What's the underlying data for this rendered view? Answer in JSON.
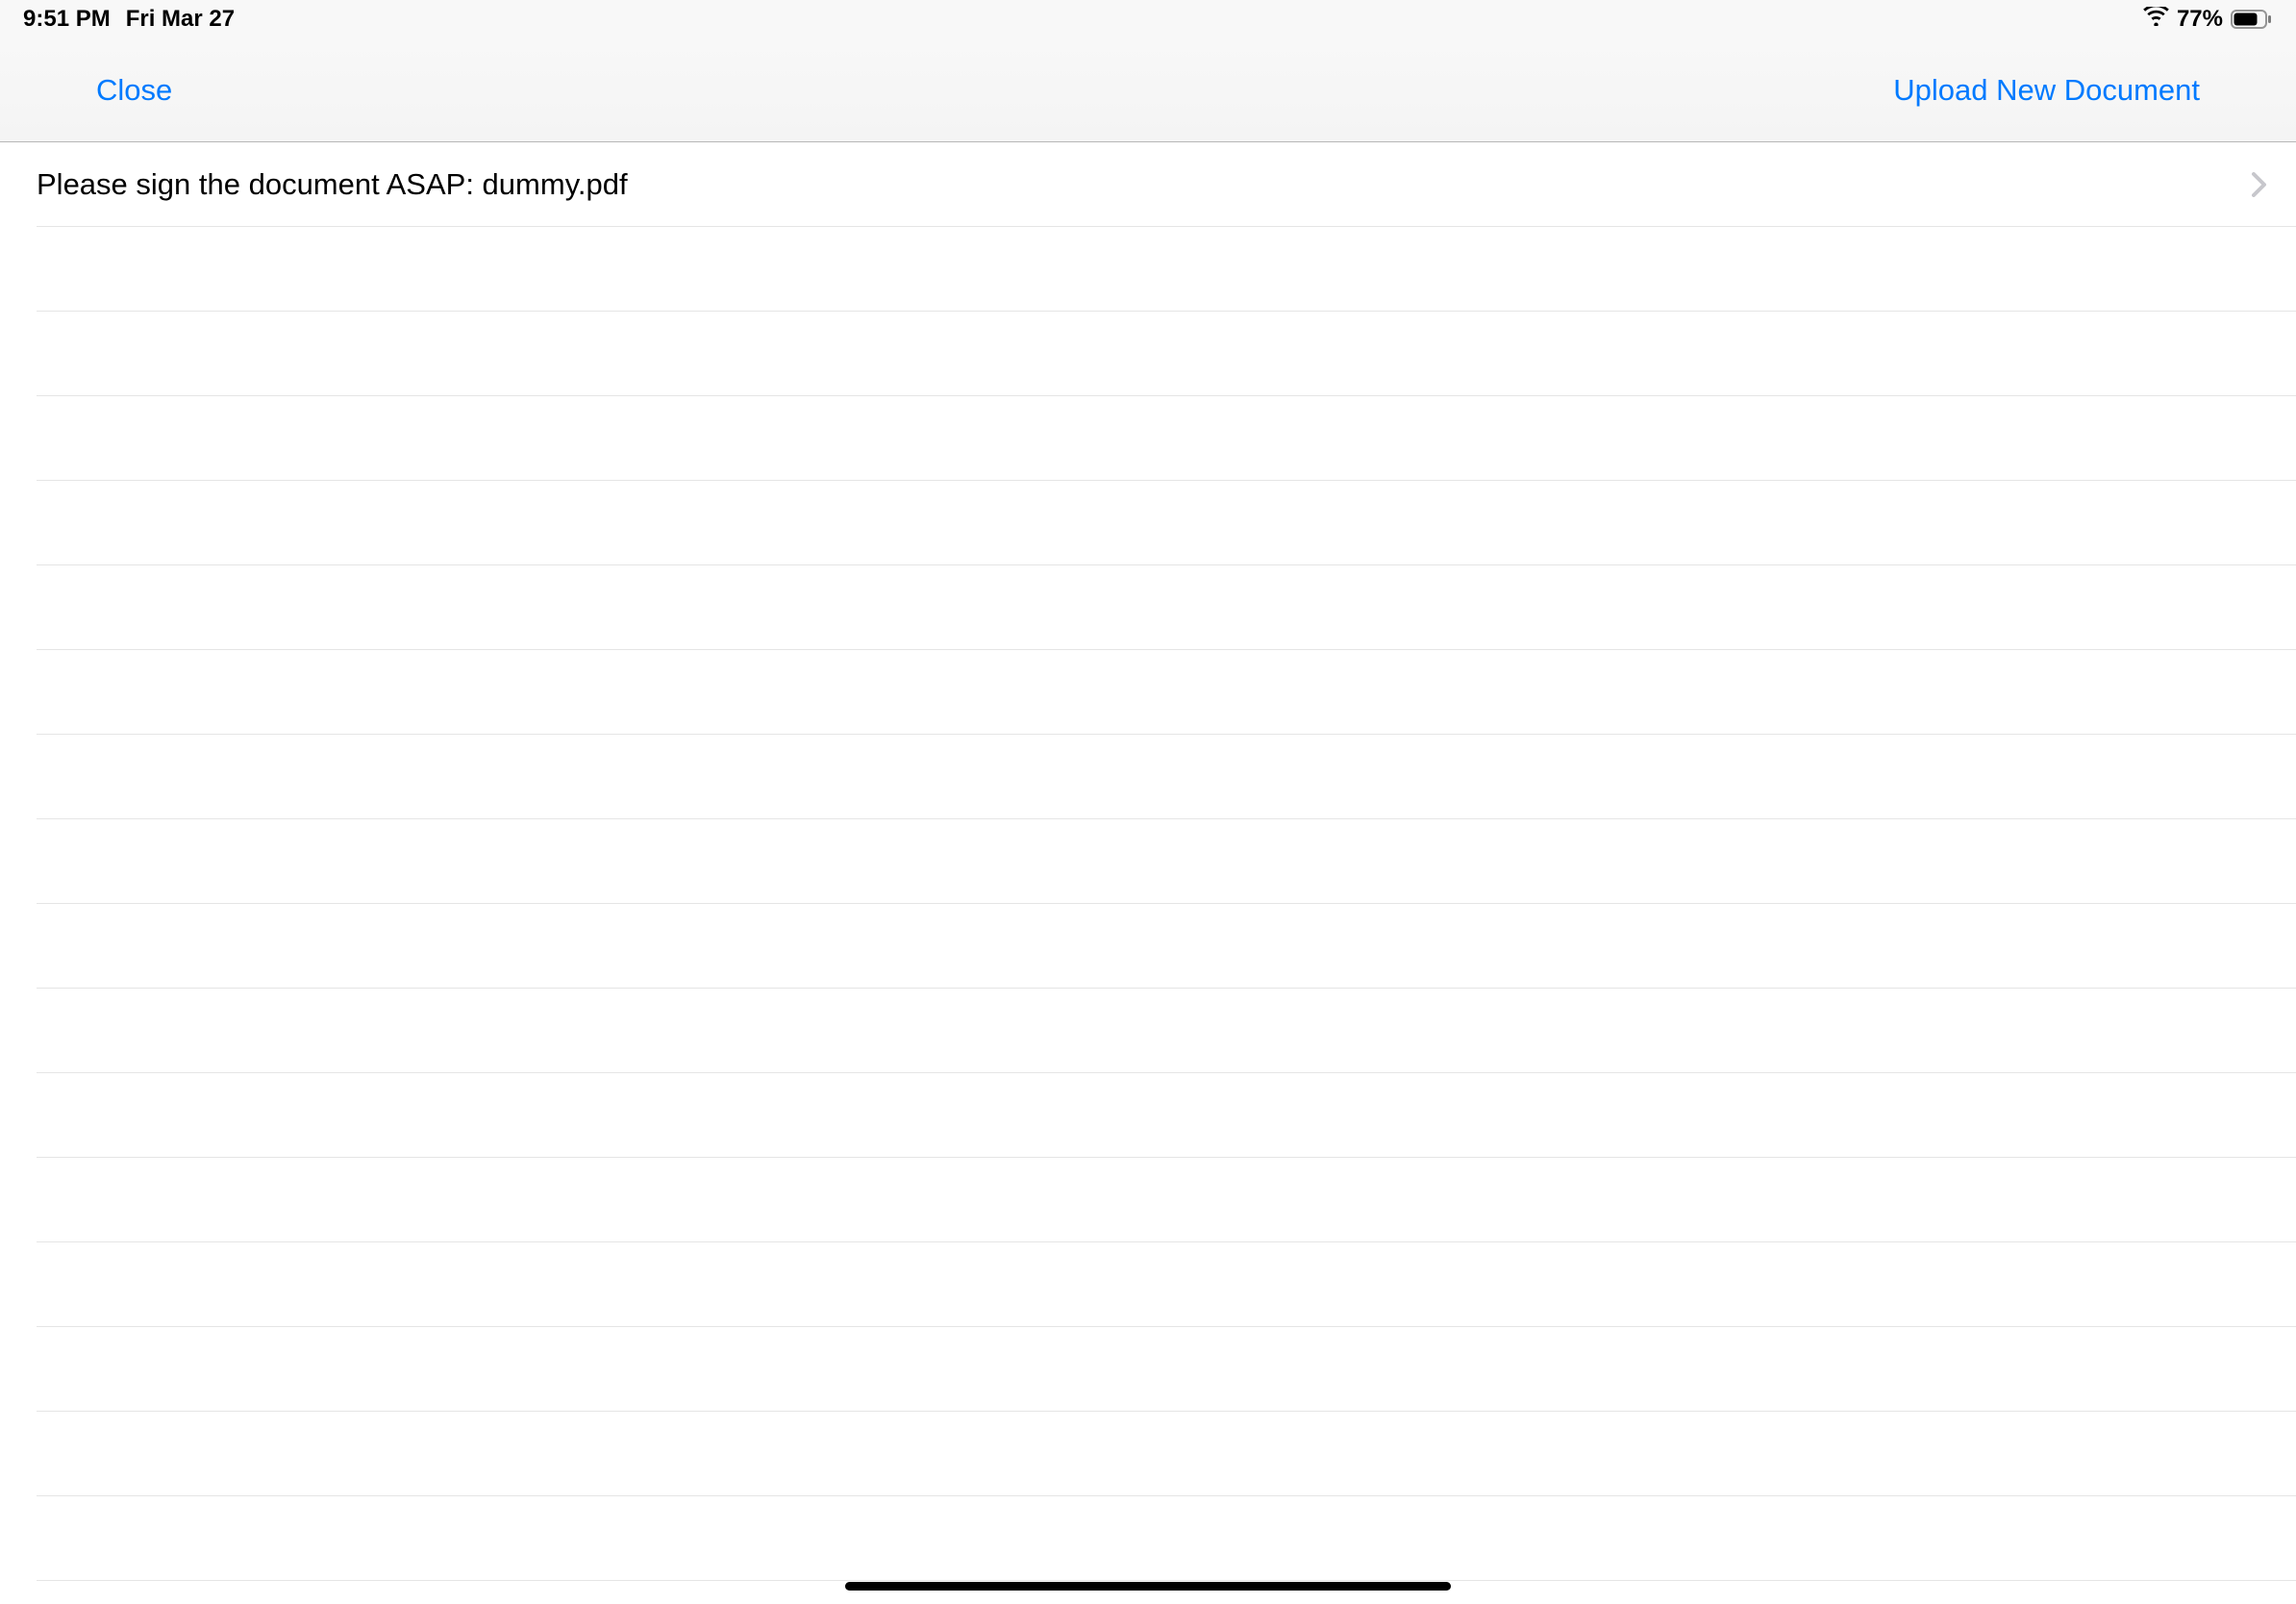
{
  "status_bar": {
    "time": "9:51 PM",
    "date": "Fri Mar 27",
    "battery_percent": "77%"
  },
  "nav": {
    "close_label": "Close",
    "upload_label": "Upload New Document"
  },
  "list": {
    "items": [
      {
        "label": "Please sign the document ASAP: dummy.pdf"
      },
      {
        "label": ""
      },
      {
        "label": ""
      },
      {
        "label": ""
      },
      {
        "label": ""
      },
      {
        "label": ""
      },
      {
        "label": ""
      },
      {
        "label": ""
      },
      {
        "label": ""
      },
      {
        "label": ""
      },
      {
        "label": ""
      },
      {
        "label": ""
      },
      {
        "label": ""
      },
      {
        "label": ""
      },
      {
        "label": ""
      },
      {
        "label": ""
      },
      {
        "label": ""
      }
    ]
  }
}
